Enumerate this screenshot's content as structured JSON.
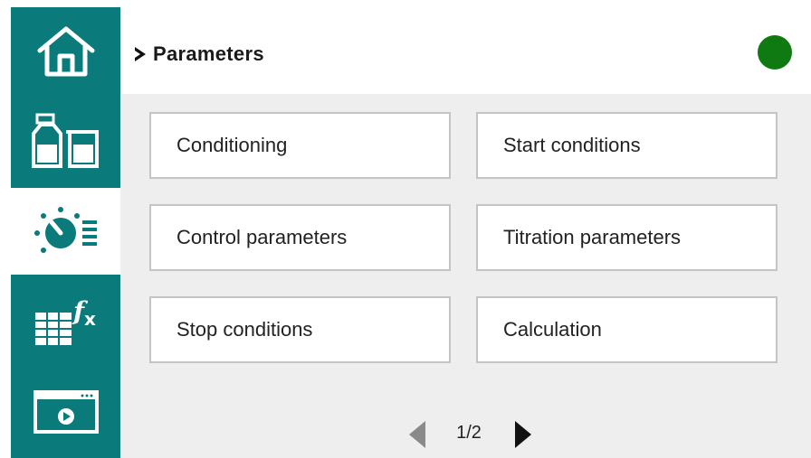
{
  "sidebar": {
    "items": [
      {
        "icon": "home-icon"
      },
      {
        "icon": "sample-bottle-beaker-icon"
      },
      {
        "icon": "parameters-dial-icon",
        "active": true
      },
      {
        "icon": "table-formula-icon"
      },
      {
        "icon": "video-screen-icon"
      }
    ]
  },
  "header": {
    "title": "Parameters",
    "status_color": "#0f7a12"
  },
  "tiles": [
    {
      "label": "Conditioning"
    },
    {
      "label": "Start conditions"
    },
    {
      "label": "Control parameters"
    },
    {
      "label": "Titration parameters"
    },
    {
      "label": "Stop conditions"
    },
    {
      "label": "Calculation"
    }
  ],
  "pager": {
    "text": "1/2"
  },
  "colors": {
    "sidebar": "#0a7a7a",
    "content_bg": "#eeeeee",
    "tile_border": "#c4c4c4"
  }
}
